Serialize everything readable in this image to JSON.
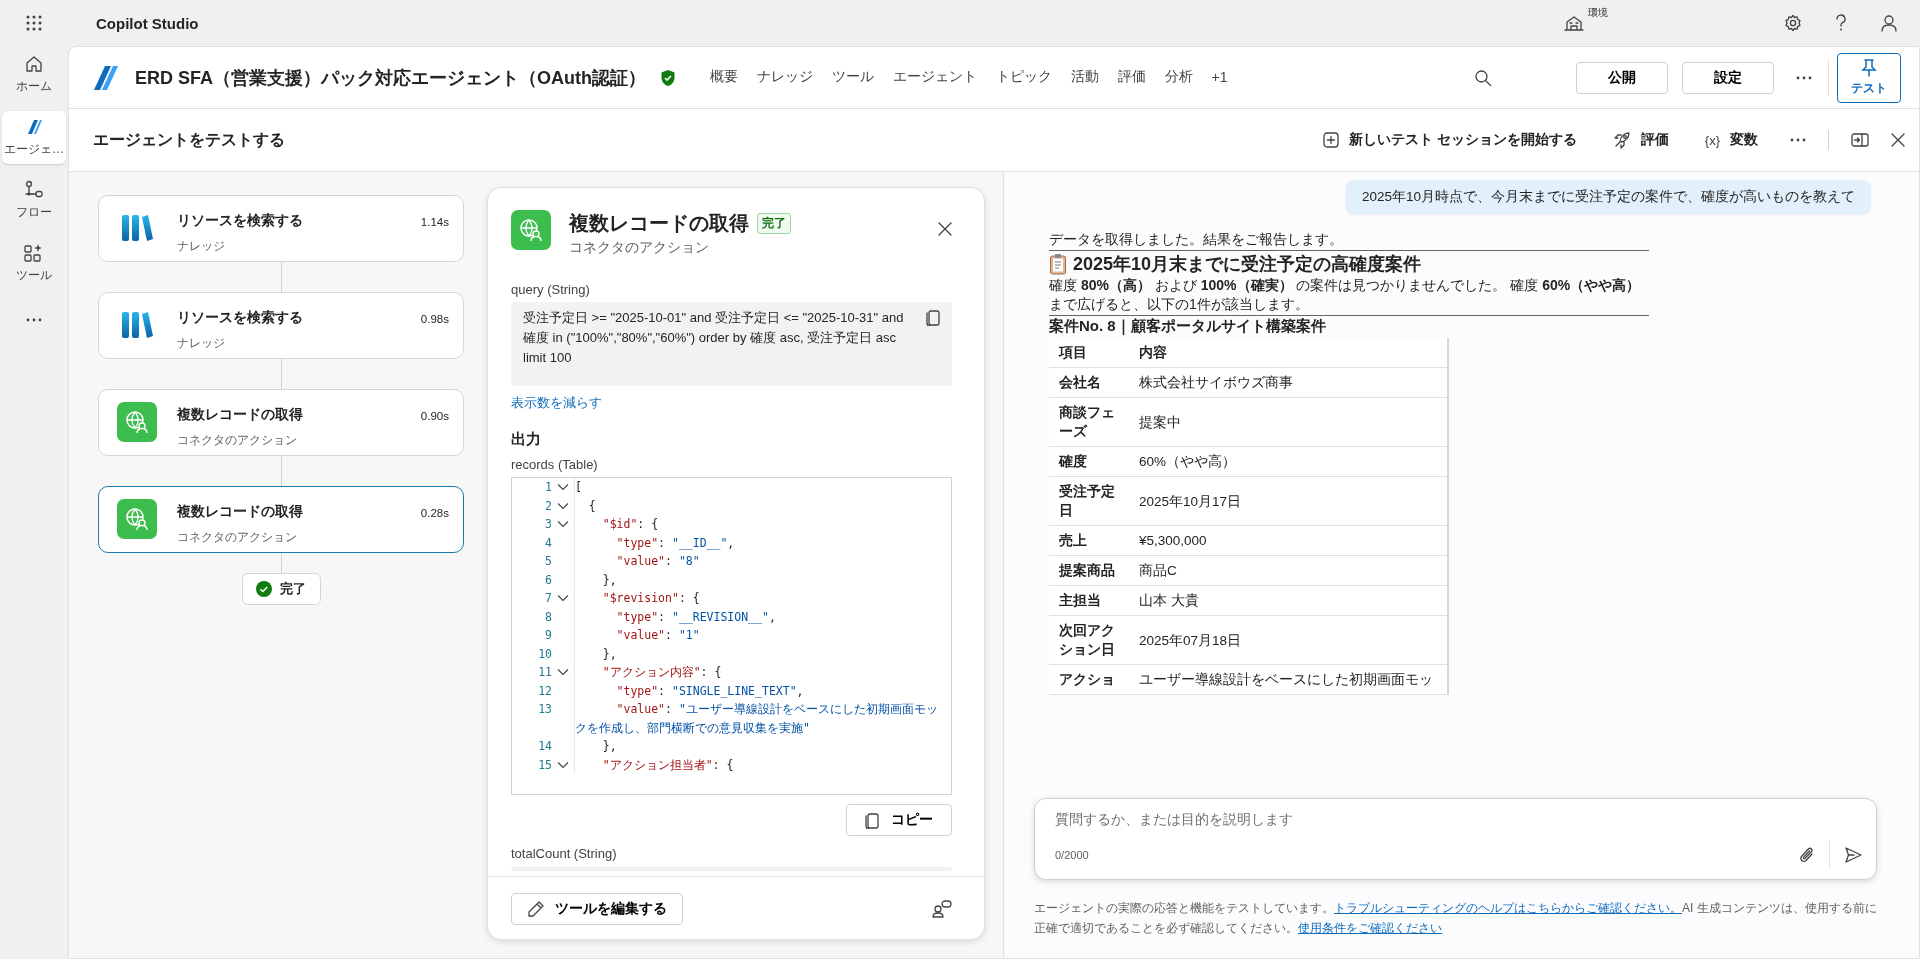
{
  "topbar": {
    "app_name": "Copilot Studio",
    "environment_label": "環境"
  },
  "rail": {
    "items": [
      {
        "kind": "home",
        "label": "ホーム",
        "selected": false
      },
      {
        "kind": "agent",
        "label": "エージェ…",
        "selected": true
      },
      {
        "kind": "flow",
        "label": "フロー",
        "selected": false
      },
      {
        "kind": "tools",
        "label": "ツール",
        "selected": false
      }
    ]
  },
  "agent": {
    "title": "ERD SFA（営業支援）パック対応エージェント（OAuth認証）",
    "tabs": [
      {
        "label": "概要",
        "selected": false
      },
      {
        "label": "ナレッジ",
        "selected": false
      },
      {
        "label": "ツール",
        "selected": false
      },
      {
        "label": "エージェント",
        "selected": false
      },
      {
        "label": "トピック",
        "selected": false
      },
      {
        "label": "活動",
        "selected": false
      },
      {
        "label": "評価",
        "selected": false
      },
      {
        "label": "分析",
        "selected": false
      },
      {
        "label": "+1",
        "selected": false
      }
    ],
    "buttons": [
      "公開",
      "設定"
    ],
    "test_button": {
      "label": "テスト",
      "selected": true
    }
  },
  "test_panel": {
    "title": "エージェントをテストする",
    "actions": [
      {
        "kind": "new-session",
        "label": "新しいテスト セッションを開始する"
      },
      {
        "kind": "evaluate",
        "label": "評価"
      },
      {
        "kind": "variables",
        "glyph": "{x}",
        "label": "変数"
      }
    ]
  },
  "flow": {
    "steps": [
      {
        "kind": "knowledge",
        "title": "リソースを検索する",
        "subtitle": "ナレッジ",
        "duration": "1.14s",
        "selected": false
      },
      {
        "kind": "knowledge",
        "title": "リソースを検索する",
        "subtitle": "ナレッジ",
        "duration": "0.98s",
        "selected": false
      },
      {
        "kind": "connector",
        "title": "複数レコードの取得",
        "subtitle": "コネクタのアクション",
        "duration": "0.90s",
        "selected": false
      },
      {
        "kind": "connector",
        "title": "複数レコードの取得",
        "subtitle": "コネクタのアクション",
        "duration": "0.28s",
        "selected": true
      }
    ],
    "status": "完了"
  },
  "detail": {
    "title": "複数レコードの取得",
    "badge": "完了",
    "subtitle": "コネクタのアクション",
    "query_label": "query (String)",
    "query": "受注予定日 >= \"2025-10-01\" and 受注予定日 <= \"2025-10-31\" and 確度 in (\"100%\",\"80%\",\"60%\") order by 確度 asc, 受注予定日 asc limit 100",
    "show_less": "表示数を減らす",
    "output_heading": "出力",
    "records_label": "records (Table)",
    "code_lines": [
      {
        "num": "1",
        "fold": true,
        "text": "["
      },
      {
        "num": "2",
        "fold": true,
        "text": "  {"
      },
      {
        "num": "3",
        "fold": true,
        "text": "    \"$id\": {"
      },
      {
        "num": "4",
        "fold": false,
        "text": "      \"type\": \"__ID__\","
      },
      {
        "num": "5",
        "fold": false,
        "text": "      \"value\": \"8\""
      },
      {
        "num": "6",
        "fold": false,
        "text": "    },"
      },
      {
        "num": "7",
        "fold": true,
        "text": "    \"$revision\": {"
      },
      {
        "num": "8",
        "fold": false,
        "text": "      \"type\": \"__REVISION__\","
      },
      {
        "num": "9",
        "fold": false,
        "text": "      \"value\": \"1\""
      },
      {
        "num": "10",
        "fold": false,
        "text": "    },"
      },
      {
        "num": "11",
        "fold": true,
        "text": "    \"アクション内容\": {"
      },
      {
        "num": "12",
        "fold": false,
        "text": "      \"type\": \"SINGLE_LINE_TEXT\","
      },
      {
        "num": "13",
        "fold": false,
        "text": "      \"value\": \"ユーザー導線設計をベースにした初期画面モックを作成し、部門横断での意見収集を実施\""
      },
      {
        "num": "14",
        "fold": false,
        "text": "    },"
      },
      {
        "num": "15",
        "fold": true,
        "text": "    \"アクション担当者\": {"
      }
    ],
    "copy_button": "コピー",
    "total_label": "totalCount (String)",
    "edit_button": "ツールを編集する"
  },
  "chat": {
    "user_message": "2025年10月時点で、今月末までに受注予定の案件で、確度が高いものを教えて",
    "reply": {
      "intro": "データを取得しました。結果をご報告します。",
      "heading": "2025年10月末までに受注予定の高確度案件",
      "summary": "確度 **80%（高）** および **100%（確実）** の案件は見つかりませんでした。 確度 **60%（やや高）**まで広げると、以下の1件が該当します。",
      "case_title": "案件No. 8｜顧客ポータルサイト構築案件",
      "table": {
        "columns": [
          "項目",
          "内容"
        ],
        "rows": [
          [
            "会社名",
            "株式会社サイボウズ商事"
          ],
          [
            "商談フェーズ",
            "提案中"
          ],
          [
            "確度",
            "60%（やや高）"
          ],
          [
            "受注予定日",
            "2025年10月17日"
          ],
          [
            "売上",
            "¥5,300,000"
          ],
          [
            "提案商品",
            "商品C"
          ],
          [
            "主担当",
            "山本 大貴"
          ],
          [
            "次回アクション日",
            "2025年07月18日"
          ],
          [
            "アクショ",
            "ユーザー導線設計をベースにした初期画面モッ"
          ]
        ]
      }
    },
    "input": {
      "placeholder": "質問するか、または目的を説明します",
      "counter": "0/2000"
    },
    "disclaimer": {
      "text": "エージェントの実際の応答と機能をテストしています。",
      "link1": "トラブルシューティングのヘルプはこちらからご確認ください。",
      "text2": "AI 生成コンテンツは、使用する前に正確で適切であることを必ず確認してください。",
      "link2": "使用条件をご確認ください"
    }
  }
}
